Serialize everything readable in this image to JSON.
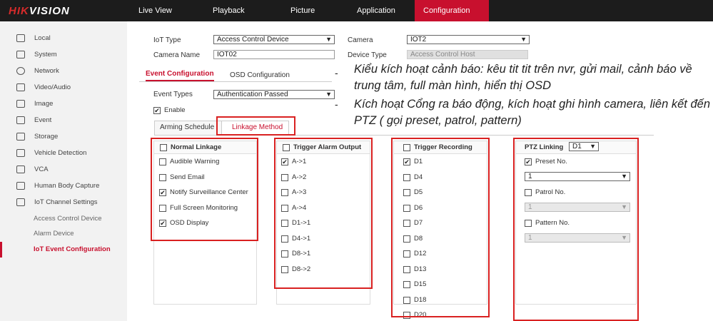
{
  "logo": {
    "part1": "HIK",
    "part2": "VISION"
  },
  "topnav": [
    {
      "label": "Live View"
    },
    {
      "label": "Playback"
    },
    {
      "label": "Picture"
    },
    {
      "label": "Application"
    },
    {
      "label": "Configuration"
    }
  ],
  "sidebar": {
    "items": [
      {
        "label": "Local"
      },
      {
        "label": "System"
      },
      {
        "label": "Network"
      },
      {
        "label": "Video/Audio"
      },
      {
        "label": "Image"
      },
      {
        "label": "Event"
      },
      {
        "label": "Storage"
      },
      {
        "label": "Vehicle Detection"
      },
      {
        "label": "VCA"
      },
      {
        "label": "Human Body Capture"
      },
      {
        "label": "IoT Channel Settings"
      },
      {
        "label": "Access Control Device"
      },
      {
        "label": "Alarm Device"
      },
      {
        "label": "IoT Event Configuration"
      }
    ]
  },
  "form": {
    "iot_type_label": "IoT Type",
    "iot_type_value": "Access Control Device",
    "camera_label": "Camera",
    "camera_value": "IOT2",
    "camera_name_label": "Camera Name",
    "camera_name_value": "IOT02",
    "device_type_label": "Device Type",
    "device_type_value": "Access Control Host"
  },
  "tabs": {
    "event_config": "Event Configuration",
    "osd_config": "OSD Configuration"
  },
  "event_types_label": "Event Types",
  "event_types_value": "Authentication Passed",
  "enable_label": "Enable",
  "subtabs": {
    "arming": "Arming Schedule",
    "linkage": "Linkage Method"
  },
  "normal_linkage": {
    "title": "Normal Linkage",
    "items": [
      {
        "label": "Audible Warning",
        "checked": false
      },
      {
        "label": "Send Email",
        "checked": false
      },
      {
        "label": "Notify Surveillance Center",
        "checked": true
      },
      {
        "label": "Full Screen Monitoring",
        "checked": false
      },
      {
        "label": "OSD Display",
        "checked": true
      }
    ]
  },
  "alarm_output": {
    "title": "Trigger Alarm Output",
    "items": [
      {
        "label": "A->1",
        "checked": true
      },
      {
        "label": "A->2",
        "checked": false
      },
      {
        "label": "A->3",
        "checked": false
      },
      {
        "label": "A->4",
        "checked": false
      },
      {
        "label": "D1->1",
        "checked": false
      },
      {
        "label": "D4->1",
        "checked": false
      },
      {
        "label": "D8->1",
        "checked": false
      },
      {
        "label": "D8->2",
        "checked": false
      }
    ]
  },
  "recording": {
    "title": "Trigger Recording",
    "items": [
      {
        "label": "D1",
        "checked": true
      },
      {
        "label": "D4",
        "checked": false
      },
      {
        "label": "D5",
        "checked": false
      },
      {
        "label": "D6",
        "checked": false
      },
      {
        "label": "D7",
        "checked": false
      },
      {
        "label": "D8",
        "checked": false
      },
      {
        "label": "D12",
        "checked": false
      },
      {
        "label": "D13",
        "checked": false
      },
      {
        "label": "D15",
        "checked": false
      },
      {
        "label": "D18",
        "checked": false
      },
      {
        "label": "D20",
        "checked": false
      }
    ]
  },
  "ptz": {
    "title": "PTZ Linking",
    "channel": "D1",
    "preset_label": "Preset No.",
    "preset_value": "1",
    "patrol_label": "Patrol No.",
    "patrol_value": "1",
    "pattern_label": "Pattern No.",
    "pattern_value": "1"
  },
  "annotations": {
    "dash": "-",
    "line1": "Kiểu kích hoạt cảnh báo: kêu tit tit trên nvr, gửi mail, cảnh báo về trung tâm, full màn hình, hiển thị OSD",
    "line2": "Kích hoạt Cổng ra báo động, kích hoạt ghi hình camera, liên kết đến PTZ ( gọi preset, patrol, pattern)"
  },
  "colors": {
    "accent": "#c8102e",
    "highlight": "#d92121",
    "topbar": "#1c1c1c"
  }
}
